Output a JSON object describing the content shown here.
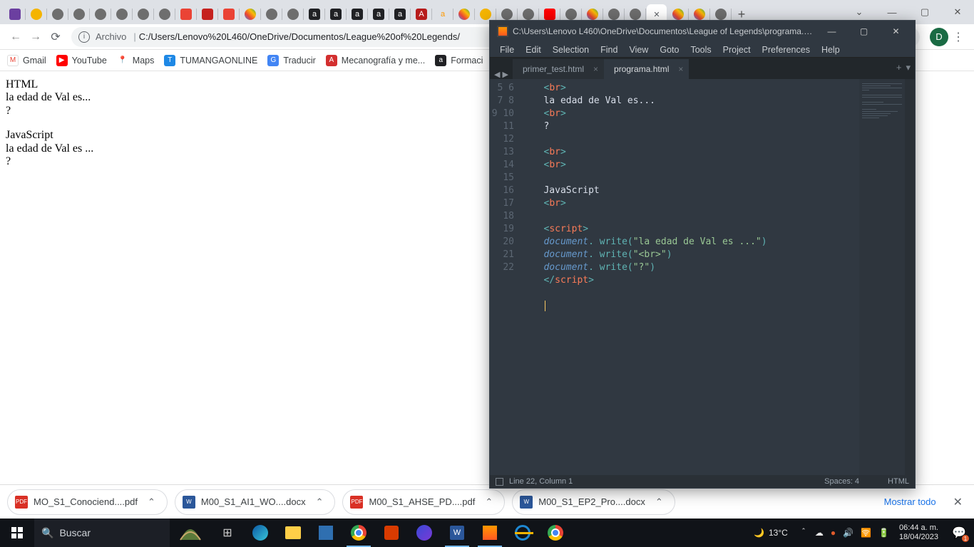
{
  "chrome": {
    "window_controls": {
      "min": "—",
      "max": "▢",
      "close": "✕",
      "dropdown": "⌄"
    },
    "address": {
      "label": "Archivo",
      "url": "C:/Users/Lenovo%20L460/OneDrive/Documentos/League%20of%20Legends/"
    },
    "profile_initial": "D",
    "bookmarks": [
      {
        "icon": "gmail",
        "color": "#ea4335",
        "label": "Gmail"
      },
      {
        "icon": "youtube",
        "color": "#ff0000",
        "label": "YouTube"
      },
      {
        "icon": "maps",
        "color": "#34a853",
        "label": "Maps"
      },
      {
        "icon": "tmo",
        "color": "#1e88e5",
        "label": "TUMANGAONLINE"
      },
      {
        "icon": "translate",
        "color": "#4285f4",
        "label": "Traducir"
      },
      {
        "icon": "meca",
        "color": "#d32f2f",
        "label": "Mecanografía y me..."
      },
      {
        "icon": "form",
        "color": "#202124",
        "label": "Formaci"
      }
    ],
    "page_lines": [
      "HTML",
      "la edad de Val es...",
      "?",
      "",
      "JavaScript",
      "la edad de Val es ...",
      "?"
    ],
    "downloads": [
      {
        "type": "pdf",
        "label": "MO_S1_Conociend....pdf"
      },
      {
        "type": "docx",
        "label": "M00_S1_AI1_WO....docx"
      },
      {
        "type": "pdf",
        "label": "M00_S1_AHSE_PD....pdf"
      },
      {
        "type": "docx",
        "label": "M00_S1_EP2_Pro....docx"
      }
    ],
    "downloads_show_all": "Mostrar todo"
  },
  "sublime": {
    "title": "C:\\Users\\Lenovo L460\\OneDrive\\Documentos\\League of Legends\\programa.ht...",
    "menus": [
      "File",
      "Edit",
      "Selection",
      "Find",
      "View",
      "Goto",
      "Tools",
      "Project",
      "Preferences",
      "Help"
    ],
    "tabs": [
      {
        "label": "primer_test.html",
        "active": false
      },
      {
        "label": "programa.html",
        "active": true
      }
    ],
    "gutter_start": 5,
    "gutter_end": 22,
    "code_lines": [
      {
        "n": 5,
        "html": "   <span class='punct'>&lt;</span><span class='tag'>br</span><span class='punct'>&gt;</span>"
      },
      {
        "n": 6,
        "html": "   la edad de Val es..."
      },
      {
        "n": 7,
        "html": "   <span class='punct'>&lt;</span><span class='tag'>br</span><span class='punct'>&gt;</span>"
      },
      {
        "n": 8,
        "html": "   ?"
      },
      {
        "n": 9,
        "html": ""
      },
      {
        "n": 10,
        "html": "   <span class='punct'>&lt;</span><span class='tag'>br</span><span class='punct'>&gt;</span>"
      },
      {
        "n": 11,
        "html": "   <span class='punct'>&lt;</span><span class='tag'>br</span><span class='punct'>&gt;</span>"
      },
      {
        "n": 12,
        "html": ""
      },
      {
        "n": 13,
        "html": "   JavaScript"
      },
      {
        "n": 14,
        "html": "   <span class='punct'>&lt;</span><span class='tag'>br</span><span class='punct'>&gt;</span>"
      },
      {
        "n": 15,
        "html": ""
      },
      {
        "n": 16,
        "html": "   <span class='punct'>&lt;</span><span class='tag'>script</span><span class='punct'>&gt;</span>"
      },
      {
        "n": 17,
        "html": "   <span class='obj'>document</span><span class='punct'>.</span> <span class='sfunc'>write</span><span class='punct'>(</span><span class='str'>\"la edad de Val es ...\"</span><span class='punct'>)</span>"
      },
      {
        "n": 18,
        "html": "   <span class='obj'>document</span><span class='punct'>.</span> <span class='sfunc'>write</span><span class='punct'>(</span><span class='str'>\"&lt;br&gt;\"</span><span class='punct'>)</span>"
      },
      {
        "n": 19,
        "html": "   <span class='obj'>document</span><span class='punct'>.</span> <span class='sfunc'>write</span><span class='punct'>(</span><span class='str'>\"?\"</span><span class='punct'>)</span>"
      },
      {
        "n": 20,
        "html": "   <span class='punct'>&lt;/</span><span class='tag'>script</span><span class='punct'>&gt;</span>"
      },
      {
        "n": 21,
        "html": ""
      },
      {
        "n": 22,
        "html": "   <span class='cursor'></span>"
      }
    ],
    "status": {
      "pos": "Line 22, Column 1",
      "spaces": "Spaces: 4",
      "syntax": "HTML"
    }
  },
  "taskbar": {
    "search_placeholder": "Buscar",
    "weather": "13°C",
    "clock": {
      "time": "06:44 a. m.",
      "date": "18/04/2023"
    },
    "notif_count": "1"
  }
}
